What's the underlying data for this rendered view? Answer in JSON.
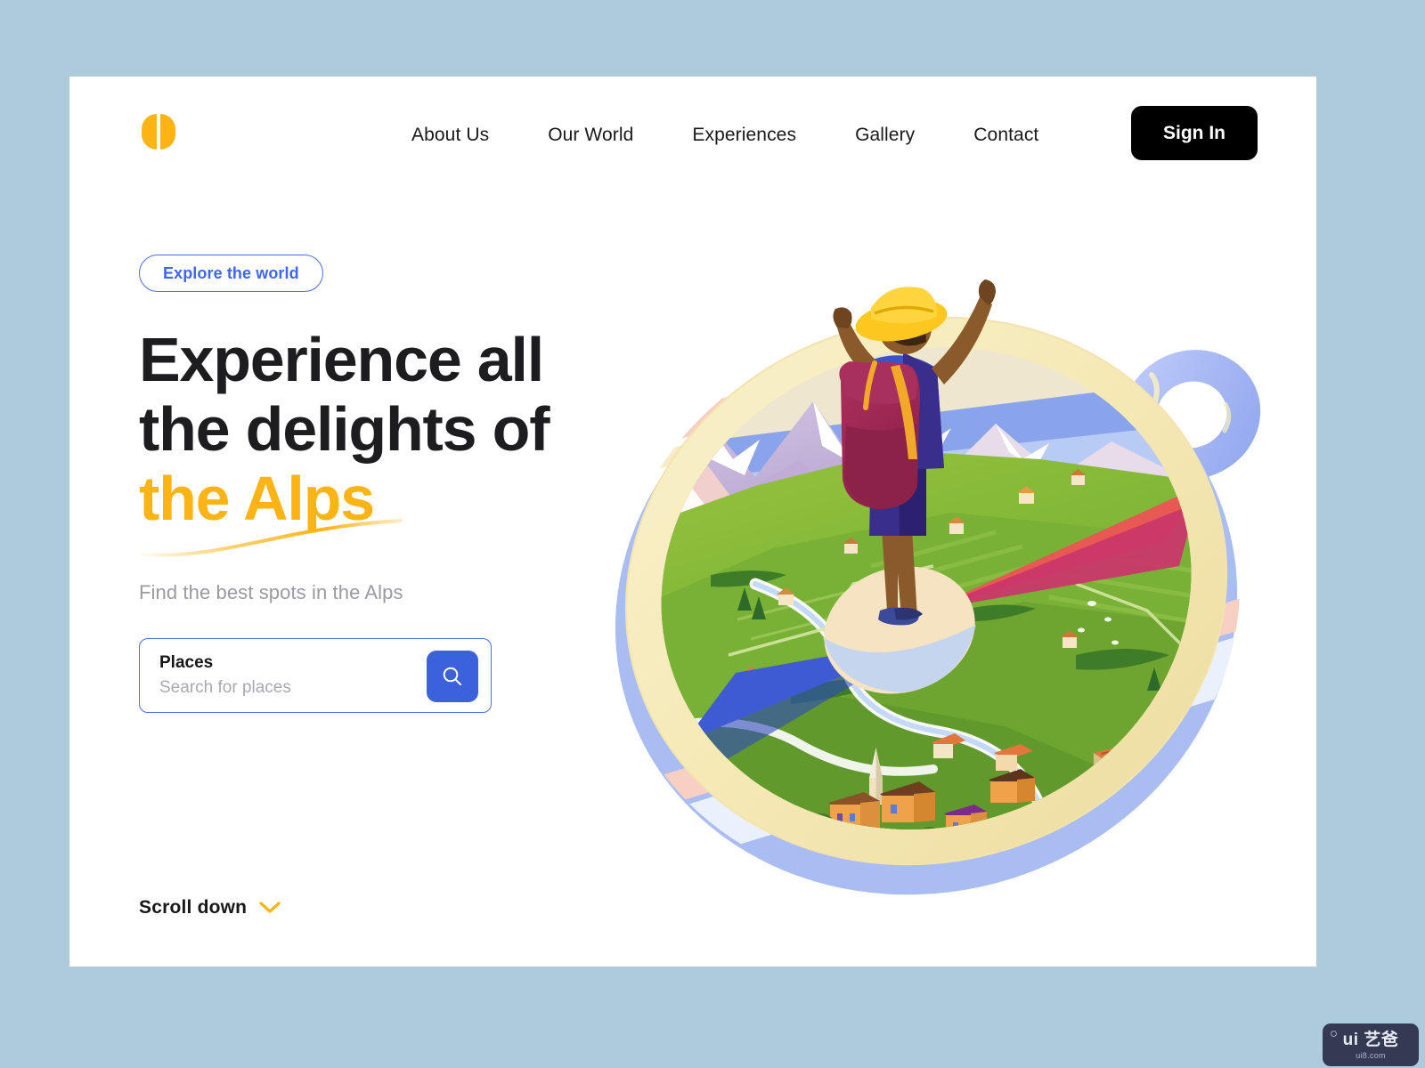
{
  "page": {
    "background_color": "#aecbdb",
    "card_background": "#ffffff"
  },
  "header": {
    "logo": {
      "icon": "split-circle-logo",
      "color": "#FCB415"
    },
    "nav_items": [
      {
        "label": "About Us"
      },
      {
        "label": "Our World"
      },
      {
        "label": "Experiences"
      },
      {
        "label": "Gallery"
      },
      {
        "label": "Contact"
      }
    ],
    "signin": {
      "label": "Sign In",
      "background": "#000000",
      "text_color": "#ffffff"
    }
  },
  "hero": {
    "pill": {
      "label": "Explore the world",
      "color": "#3f66f0",
      "border_color": "#4a6cf0"
    },
    "headline_line1": "Experience all",
    "headline_line2": "the delights of",
    "headline_accent": "the Alps",
    "headline_color": "#1d1d20",
    "accent_color": "#FCB415",
    "subtitle": "Find the best spots in the Alps"
  },
  "search": {
    "label": "Places",
    "placeholder": "Search for places",
    "value": "",
    "button_icon": "search-icon",
    "button_color": "#3B62DB",
    "border_color": "#4a6cf0"
  },
  "scroll": {
    "label": "Scroll down",
    "icon": "chevron-down-icon",
    "icon_color": "#FCB415"
  },
  "illustration": {
    "name": "compass-alps-illustration",
    "description": "Isometric compass containing an alpine landscape with a hiker standing on the needle",
    "colors": {
      "bezel_cream": "#F7EEC0",
      "bezel_outer_blue": "#9FB4F2",
      "bezel_pink": "#F7C9BE",
      "needle_north": "#F4572A",
      "needle_north_shadow": "#C9386B",
      "needle_south": "#3E5BD4",
      "hub_cream": "#F5E3C2",
      "meadow_green": "#7CB23A",
      "meadow_green_dark": "#4E8E2C",
      "mountain_lavender": "#B3A0CE",
      "mountain_pink": "#F0C9C9",
      "river_blue": "#BBD2F5",
      "loop_ring": "#A9BCF4",
      "hiker_hat": "#FCC71E",
      "hiker_shirt": "#3B53C7",
      "hiker_shirt_dark": "#3A2E8C",
      "hiker_backpack": "#9E2A55",
      "hiker_skin": "#8A5A2B",
      "house_orange": "#F0A24B",
      "roof_brown": "#8A5327"
    }
  },
  "watermark": {
    "main": "ui 艺爸",
    "sub": "ui8.com",
    "background": "#343a52"
  }
}
